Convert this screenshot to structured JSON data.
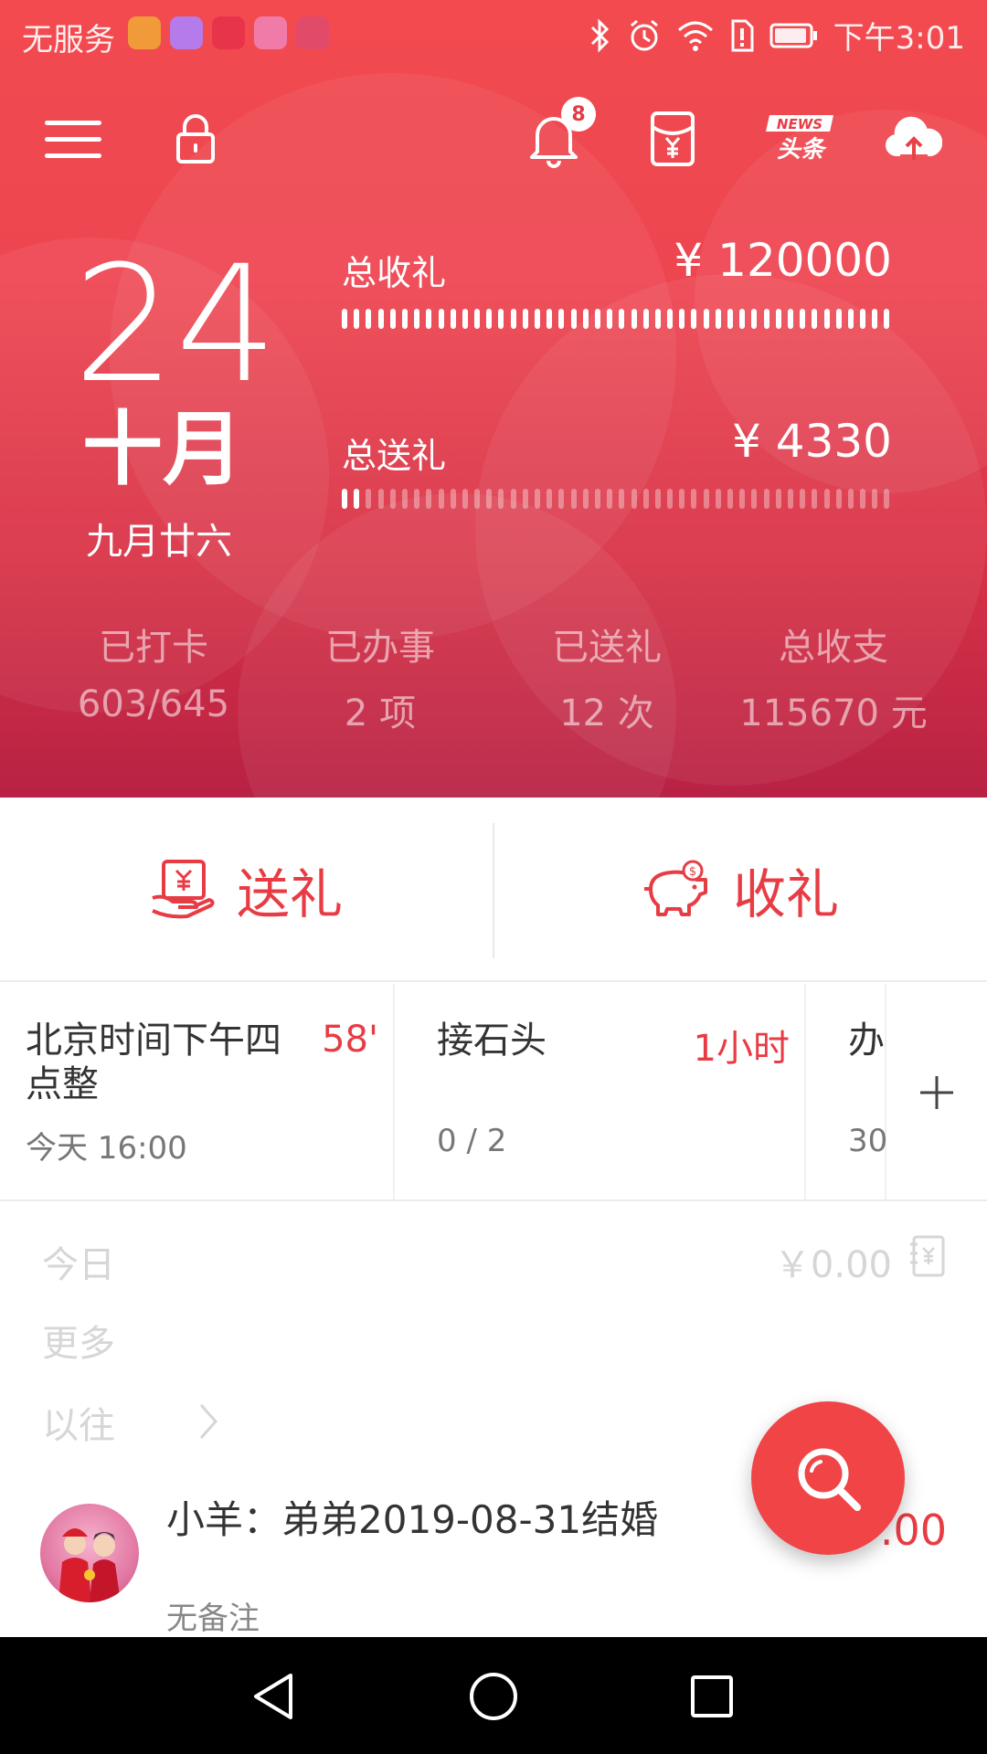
{
  "status_bar": {
    "carrier": "无服务",
    "time": "下午3:01",
    "app_icon_colors": [
      "#f09a3a",
      "#b57bea",
      "#e8344a",
      "#f07ba8",
      "#e24a6a"
    ]
  },
  "toolbar": {
    "menu_icon": "menu-icon",
    "lock_icon": "lock-icon",
    "bell_icon": "bell-icon",
    "notification_count": "8",
    "red_envelope_icon": "red-envelope-icon",
    "news_icon": "news-icon",
    "news_label_top": "NEWS",
    "news_label_bottom": "头条",
    "cloud_icon": "cloud-upload-icon"
  },
  "date": {
    "day": "24",
    "month": "十月",
    "lunar": "九月廿六"
  },
  "totals": {
    "received_label": "总收礼",
    "received_value": "¥ 120000",
    "received_fill": 1.0,
    "sent_label": "总送礼",
    "sent_value": "¥ 4330",
    "sent_fill": 0.04
  },
  "stats": [
    {
      "label": "已打卡",
      "value": "603/645"
    },
    {
      "label": "已办事",
      "value": "2 项"
    },
    {
      "label": "已送礼",
      "value": "12 次"
    },
    {
      "label": "总收支",
      "value": "115670 元"
    }
  ],
  "actions": {
    "send_label": "送礼",
    "receive_label": "收礼"
  },
  "events": [
    {
      "title": "北京时间下午四点整",
      "countdown": "58'",
      "sub": "今天 16:00"
    },
    {
      "title": "接石头",
      "countdown": "1小时",
      "sub": "0 / 2"
    },
    {
      "title": "办",
      "countdown": "",
      "sub": "30"
    }
  ],
  "list": {
    "today_label": "今日",
    "today_amount": "￥0.00",
    "more_label": "更多",
    "past_label": "以往"
  },
  "record": {
    "title": "小羊：弟弟2019-08-31结婚",
    "note": "无备注",
    "amount": ".00"
  },
  "colors": {
    "accent": "#e83c45",
    "header_top": "#f24a4f",
    "header_bottom": "#b82244"
  }
}
